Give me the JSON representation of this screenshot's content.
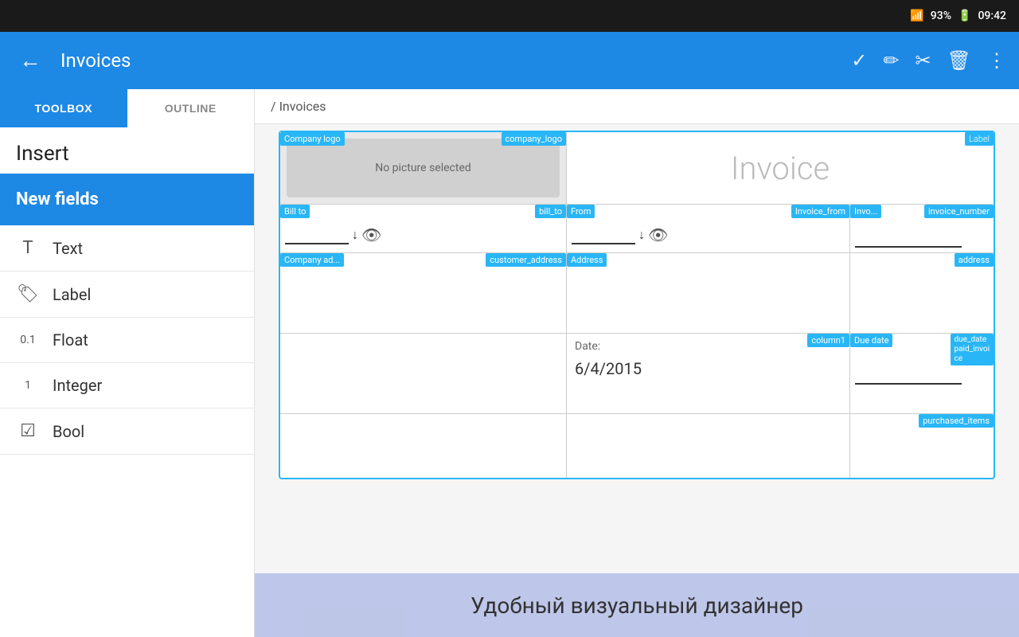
{
  "statusBar": {
    "wifi": "📶",
    "battery": "93%",
    "time": "09:42"
  },
  "appBar": {
    "backLabel": "←",
    "title": "Invoices",
    "icons": {
      "check": "✓",
      "edit": "✏",
      "eraser": "⌦",
      "delete": "🗑",
      "more": "⋮"
    }
  },
  "sidebar": {
    "tab1": "TOOLBOX",
    "tab2": "OUTLINE",
    "insertLabel": "Insert",
    "newFieldsLabel": "New fields",
    "items": [
      {
        "icon": "T",
        "label": "Text"
      },
      {
        "icon": "🏷",
        "label": "Label"
      },
      {
        "icon": "0.1",
        "label": "Float"
      },
      {
        "icon": "1",
        "label": "Integer"
      },
      {
        "icon": "☑",
        "label": "Bool"
      }
    ]
  },
  "breadcrumb": "/ Invoices",
  "canvas": {
    "companyLogoLabel": "Company logo",
    "companyLogoTag": "company_logo",
    "noImageText": "No picture selected",
    "invoiceTitle": "Invoice",
    "labelTag": "Label",
    "billToLabel": "Bill to",
    "billToTag": "bill_to",
    "fromLabel": "From",
    "fromTag": "Invoice_from",
    "invNumTag": "invoice_number",
    "companyAddrLabel": "Company ad...",
    "companyAddrTag": "customer_address",
    "addressLabel": "Address",
    "addressTag": "address",
    "dateLabel": "Date:",
    "dateValue": "6/4/2015",
    "col1Tag": "column1",
    "dueDateLabel": "Due date",
    "dueDateTag": "due_date",
    "paidInvoiceTag": "paid_invoice",
    "purchasedTag": "purchased_items"
  },
  "overlay": {
    "text": "Удобный визуальный дизайнер"
  }
}
